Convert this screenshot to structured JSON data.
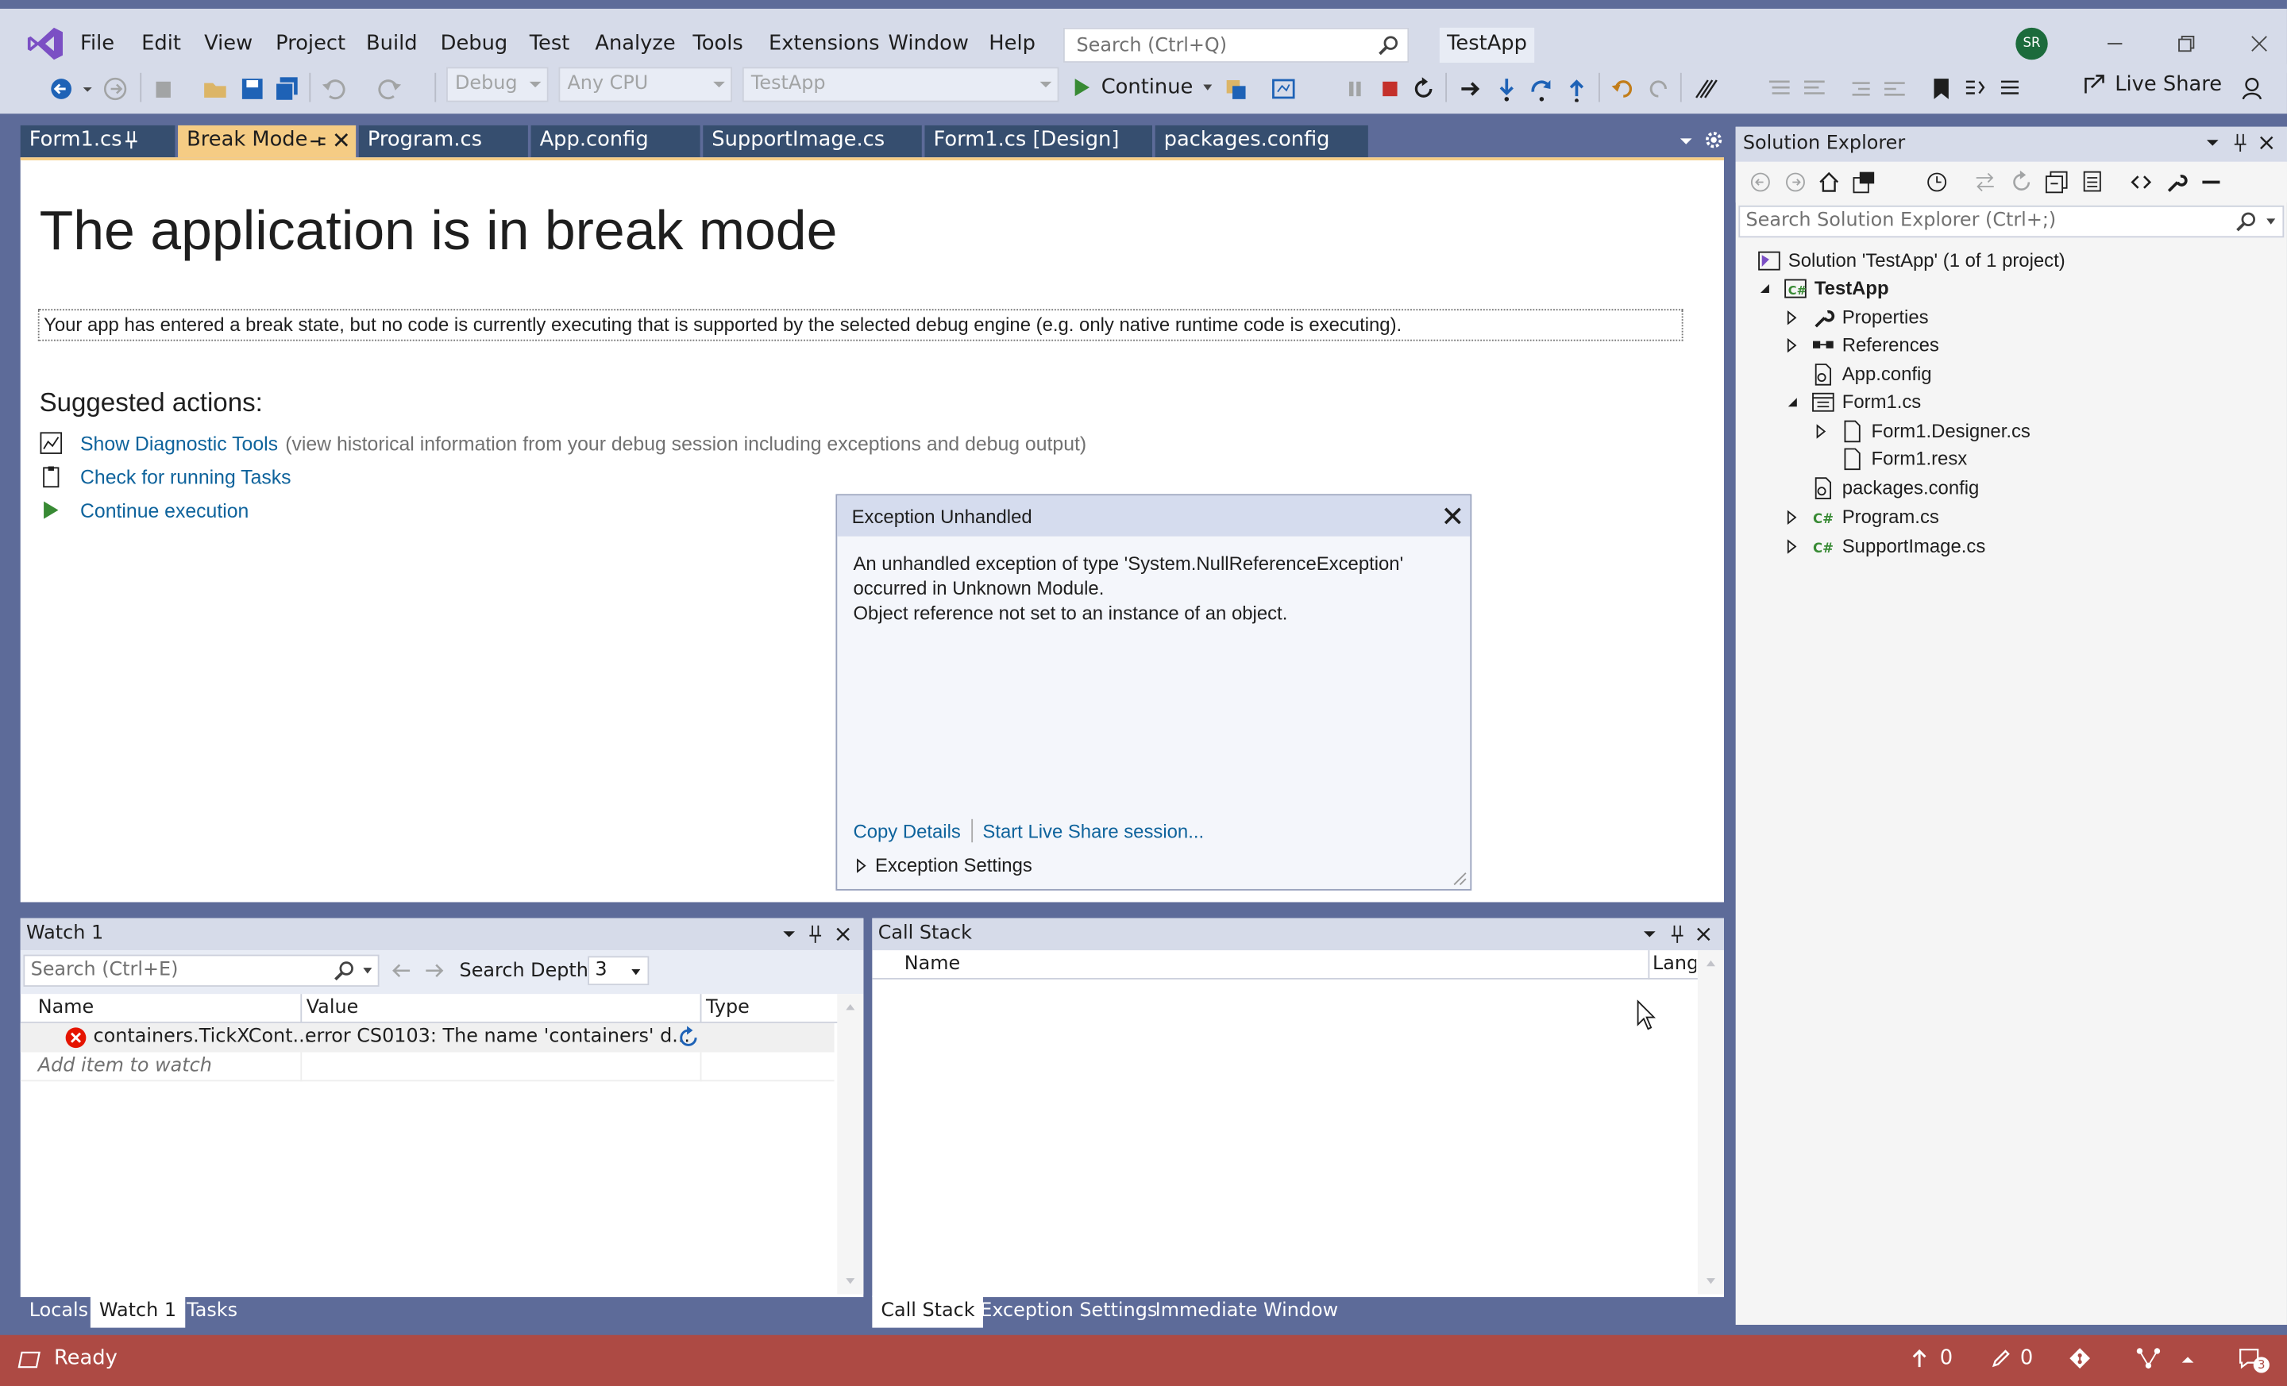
{
  "menu": [
    "File",
    "Edit",
    "View",
    "Project",
    "Build",
    "Debug",
    "Test",
    "Analyze",
    "Tools",
    "Extensions",
    "Window",
    "Help"
  ],
  "search": {
    "placeholder": "Search (Ctrl+Q)"
  },
  "solution_name": "TestApp",
  "avatar_initials": "SR",
  "toolbar": {
    "config": "Debug",
    "platform": "Any CPU",
    "startup": "TestApp",
    "continue_label": "Continue",
    "live_share_label": "Live Share"
  },
  "doc_tabs": [
    "Form1.cs",
    "Break Mode",
    "Program.cs",
    "App.config",
    "SupportImage.cs",
    "Form1.cs [Design]",
    "packages.config"
  ],
  "break_mode": {
    "title": "The application is in break mode",
    "message": "Your app has entered a break state, but no code is currently executing that is supported by the selected debug engine (e.g. only native runtime code is executing).",
    "suggested_heading": "Suggested actions:",
    "actions": [
      {
        "label": "Show Diagnostic Tools",
        "note": "(view historical information from your debug session including exceptions and debug output)"
      },
      {
        "label": "Check for running Tasks",
        "note": ""
      },
      {
        "label": "Continue execution",
        "note": ""
      }
    ]
  },
  "exception": {
    "title": "Exception Unhandled",
    "line1": "An unhandled exception of type 'System.NullReferenceException'",
    "line2": "occurred in Unknown Module.",
    "line3": "Object reference not set to an instance of an object.",
    "copy_details": "Copy Details",
    "live_share": "Start Live Share session...",
    "settings": "Exception Settings"
  },
  "solution_explorer": {
    "title": "Solution Explorer",
    "search_placeholder": "Search Solution Explorer (Ctrl+;)",
    "items": [
      {
        "label": "Solution 'TestApp' (1 of 1 project)"
      },
      {
        "label": "TestApp"
      },
      {
        "label": "Properties"
      },
      {
        "label": "References"
      },
      {
        "label": "App.config"
      },
      {
        "label": "Form1.cs"
      },
      {
        "label": "Form1.Designer.cs"
      },
      {
        "label": "Form1.resx"
      },
      {
        "label": "packages.config"
      },
      {
        "label": "Program.cs"
      },
      {
        "label": "SupportImage.cs"
      }
    ]
  },
  "watch": {
    "title": "Watch 1",
    "search_placeholder": "Search (Ctrl+E)",
    "search_depth_label": "Search Depth:",
    "search_depth_value": "3",
    "columns": [
      "Name",
      "Value",
      "Type"
    ],
    "row_name": "containers.TickXCont...",
    "row_value": "error CS0103: The name 'containers' d...",
    "add_item": "Add item to watch",
    "tabs": [
      "Locals",
      "Watch 1",
      "Tasks"
    ]
  },
  "call_stack": {
    "title": "Call Stack",
    "columns": [
      "Name",
      "Langu"
    ],
    "tabs": [
      "Call Stack",
      "Exception Settings",
      "Immediate Window"
    ]
  },
  "status": {
    "text": "Ready",
    "up_count": "0",
    "pencil_count": "0",
    "notif_count": "3"
  },
  "colors": {
    "frame": "#5d6b99",
    "status_break": "#ad4a44",
    "tab_active": "#f5cc84",
    "link": "#0e639c"
  }
}
